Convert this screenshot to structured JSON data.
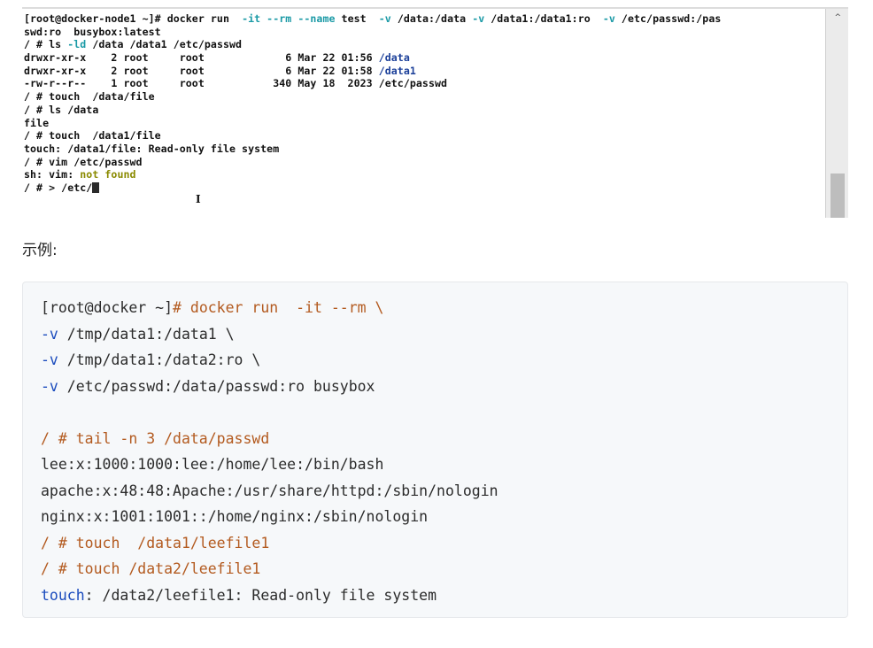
{
  "terminal": {
    "lines": [
      [
        {
          "t": "[root@docker-node1 ~]# docker run  ",
          "c": ""
        },
        {
          "t": "-it --rm --name",
          "c": "c-cyan"
        },
        {
          "t": " test  ",
          "c": ""
        },
        {
          "t": "-v",
          "c": "c-cyan"
        },
        {
          "t": " /data:/data ",
          "c": ""
        },
        {
          "t": "-v",
          "c": "c-cyan"
        },
        {
          "t": " /data1:/data1:ro  ",
          "c": ""
        },
        {
          "t": "-v",
          "c": "c-cyan"
        },
        {
          "t": " /etc/passwd:/pas",
          "c": ""
        }
      ],
      [
        {
          "t": "swd:ro  busybox:latest",
          "c": ""
        }
      ],
      [
        {
          "t": "/ # ls ",
          "c": ""
        },
        {
          "t": "-ld",
          "c": "c-cyan"
        },
        {
          "t": " /data /data1 /etc/passwd",
          "c": ""
        }
      ],
      [
        {
          "t": "drwxr-xr-x    2 root     root             6 Mar 22 01:56 ",
          "c": ""
        },
        {
          "t": "/data",
          "c": "c-blue"
        }
      ],
      [
        {
          "t": "drwxr-xr-x    2 root     root             6 Mar 22 01:58 ",
          "c": ""
        },
        {
          "t": "/data1",
          "c": "c-blue"
        }
      ],
      [
        {
          "t": "-rw-r--r--    1 root     root           340 May 18  2023 /etc/passwd",
          "c": ""
        }
      ],
      [
        {
          "t": "/ # touch  /data/file",
          "c": ""
        }
      ],
      [
        {
          "t": "/ # ls /data",
          "c": ""
        }
      ],
      [
        {
          "t": "file",
          "c": ""
        }
      ],
      [
        {
          "t": "/ # touch  /data1/file",
          "c": ""
        }
      ],
      [
        {
          "t": "touch: /data1/file: Read-only file system",
          "c": ""
        }
      ],
      [
        {
          "t": "/ # vim /etc/passwd",
          "c": ""
        }
      ],
      [
        {
          "t": "sh: vim: ",
          "c": ""
        },
        {
          "t": "not found",
          "c": "c-olive"
        }
      ],
      [
        {
          "t": "/ # > /etc/",
          "c": ""
        }
      ]
    ]
  },
  "caption": "示例:",
  "code_block": {
    "lines": [
      [
        {
          "t": "[root@docker ~]",
          "c": ""
        },
        {
          "t": "# docker run  -it --rm \\",
          "c": "k-brown"
        }
      ],
      [
        {
          "t": "-v",
          "c": "k-blue"
        },
        {
          "t": " /tmp/data1:/data1 \\",
          "c": ""
        }
      ],
      [
        {
          "t": "-v",
          "c": "k-blue"
        },
        {
          "t": " /tmp/data1:/data2:ro \\",
          "c": ""
        }
      ],
      [
        {
          "t": "-v",
          "c": "k-blue"
        },
        {
          "t": " /etc/passwd:/data/passwd:ro busybox",
          "c": ""
        }
      ],
      [
        {
          "t": "",
          "c": ""
        }
      ],
      [
        {
          "t": "/ # tail -n 3 /data/passwd",
          "c": "k-brown"
        }
      ],
      [
        {
          "t": "lee:x:1000:1000:lee:/home/lee:/bin/bash",
          "c": ""
        }
      ],
      [
        {
          "t": "apache:x:48:48:Apache:/usr/share/httpd:/sbin/nologin",
          "c": ""
        }
      ],
      [
        {
          "t": "nginx:x:1001:1001::/home/nginx:/sbin/nologin",
          "c": ""
        }
      ],
      [
        {
          "t": "/ # touch  /data1/leefile1",
          "c": "k-brown"
        }
      ],
      [
        {
          "t": "/ # touch /data2/leefile1",
          "c": "k-brown"
        }
      ],
      [
        {
          "t": "touch",
          "c": "k-blue"
        },
        {
          "t": ": /data2/leefile1: Read-only file system",
          "c": ""
        }
      ]
    ]
  }
}
